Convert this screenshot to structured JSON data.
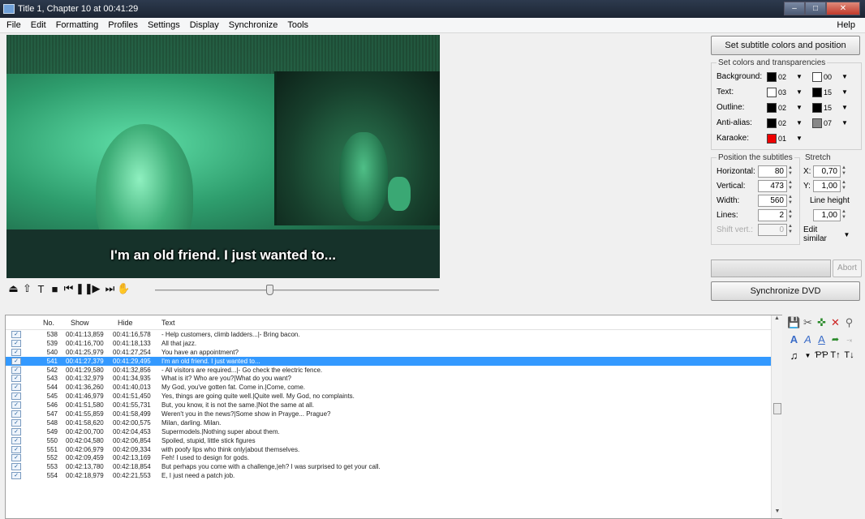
{
  "window": {
    "title": "Title 1, Chapter 10 at 00:41:29"
  },
  "menu": {
    "items": [
      "File",
      "Edit",
      "Formatting",
      "Profiles",
      "Settings",
      "Display",
      "Synchronize",
      "Tools"
    ],
    "help": "Help"
  },
  "video": {
    "subtitle": "I'm an old friend. I just wanted to..."
  },
  "transport": {
    "seek_position": 0.39
  },
  "panel": {
    "set_button": "Set subtitle colors and position",
    "colors_legend": "Set colors and transparencies",
    "colors": [
      {
        "label": "Background:",
        "c1": "#000000",
        "v1": "02",
        "c2": "#ffffff",
        "v2": "00"
      },
      {
        "label": "Text:",
        "c1": "#ffffff",
        "v1": "03",
        "c2": "#000000",
        "v2": "15"
      },
      {
        "label": "Outline:",
        "c1": "#000000",
        "v1": "02",
        "c2": "#000000",
        "v2": "15"
      },
      {
        "label": "Anti-alias:",
        "c1": "#000000",
        "v1": "02",
        "c2": "#888888",
        "v2": "07"
      },
      {
        "label": "Karaoke:",
        "c1": "#ee0000",
        "v1": "01",
        "c2": null,
        "v2": null
      }
    ],
    "position_legend": "Position the subtitles",
    "position": [
      {
        "label": "Horizontal:",
        "value": "80"
      },
      {
        "label": "Vertical:",
        "value": "473"
      },
      {
        "label": "Width:",
        "value": "560"
      },
      {
        "label": "Lines:",
        "value": "2"
      },
      {
        "label": "Shift vert.:",
        "value": "0"
      }
    ],
    "stretch_legend": "Stretch",
    "stretch_x_label": "X:",
    "stretch_x": "0,70",
    "stretch_y_label": "Y:",
    "stretch_y": "1,00",
    "line_height_label": "Line height",
    "line_height": "1,00",
    "edit_similar": "Edit similar",
    "abort": "Abort",
    "sync_button": "Synchronize DVD"
  },
  "list": {
    "columns": [
      "No.",
      "Show",
      "Hide",
      "Text"
    ],
    "rows": [
      {
        "no": "538",
        "show": "00:41:13,859",
        "hide": "00:41:16,578",
        "text": "- Help customers, climb ladders...|- Bring bacon.",
        "checked": true
      },
      {
        "no": "539",
        "show": "00:41:16,700",
        "hide": "00:41:18,133",
        "text": "All that jazz.",
        "checked": true
      },
      {
        "no": "540",
        "show": "00:41:25,979",
        "hide": "00:41:27,254",
        "text": "You have an appointment?",
        "checked": true
      },
      {
        "no": "541",
        "show": "00:41:27,379",
        "hide": "00:41:29,495",
        "text": "I'm an old friend. I just wanted to...",
        "checked": true,
        "selected": true
      },
      {
        "no": "542",
        "show": "00:41:29,580",
        "hide": "00:41:32,856",
        "text": "- All visitors are required...|- Go check the electric fence.",
        "checked": true
      },
      {
        "no": "543",
        "show": "00:41:32,979",
        "hide": "00:41:34,935",
        "text": "What is it? Who are you?|What do you want?",
        "checked": true
      },
      {
        "no": "544",
        "show": "00:41:36,260",
        "hide": "00:41:40,013",
        "text": "My God, you've gotten fat. Come in.|Come, come.",
        "checked": true
      },
      {
        "no": "545",
        "show": "00:41:46,979",
        "hide": "00:41:51,450",
        "text": "Yes, things are going quite well.|Quite well. My God, no complaints.",
        "checked": true
      },
      {
        "no": "546",
        "show": "00:41:51,580",
        "hide": "00:41:55,731",
        "text": "But, you know, it is not the same.|Not the same at all.",
        "checked": true
      },
      {
        "no": "547",
        "show": "00:41:55,859",
        "hide": "00:41:58,499",
        "text": "Weren't you in the news?|Some show in Prayge... Prague?",
        "checked": true
      },
      {
        "no": "548",
        "show": "00:41:58,620",
        "hide": "00:42:00,575",
        "text": "Milan, darling. Milan.",
        "checked": true
      },
      {
        "no": "549",
        "show": "00:42:00,700",
        "hide": "00:42:04,453",
        "text": "Supermodels.|Nothing super about them.",
        "checked": true
      },
      {
        "no": "550",
        "show": "00:42:04,580",
        "hide": "00:42:06,854",
        "text": "Spoiled, stupid, little stick figures",
        "checked": true
      },
      {
        "no": "551",
        "show": "00:42:06,979",
        "hide": "00:42:09,334",
        "text": "with poofy lips who think only|about themselves.",
        "checked": true
      },
      {
        "no": "552",
        "show": "00:42:09,459",
        "hide": "00:42:13,169",
        "text": "Feh! I used to design for gods.",
        "checked": true
      },
      {
        "no": "553",
        "show": "00:42:13,780",
        "hide": "00:42:18,854",
        "text": "But perhaps you come with a challenge,|eh? I was surprised to get your call.",
        "checked": true
      },
      {
        "no": "554",
        "show": "00:42:18,979",
        "hide": "00:42:21,553",
        "text": "E, I just need a patch job.",
        "checked": true
      }
    ]
  }
}
